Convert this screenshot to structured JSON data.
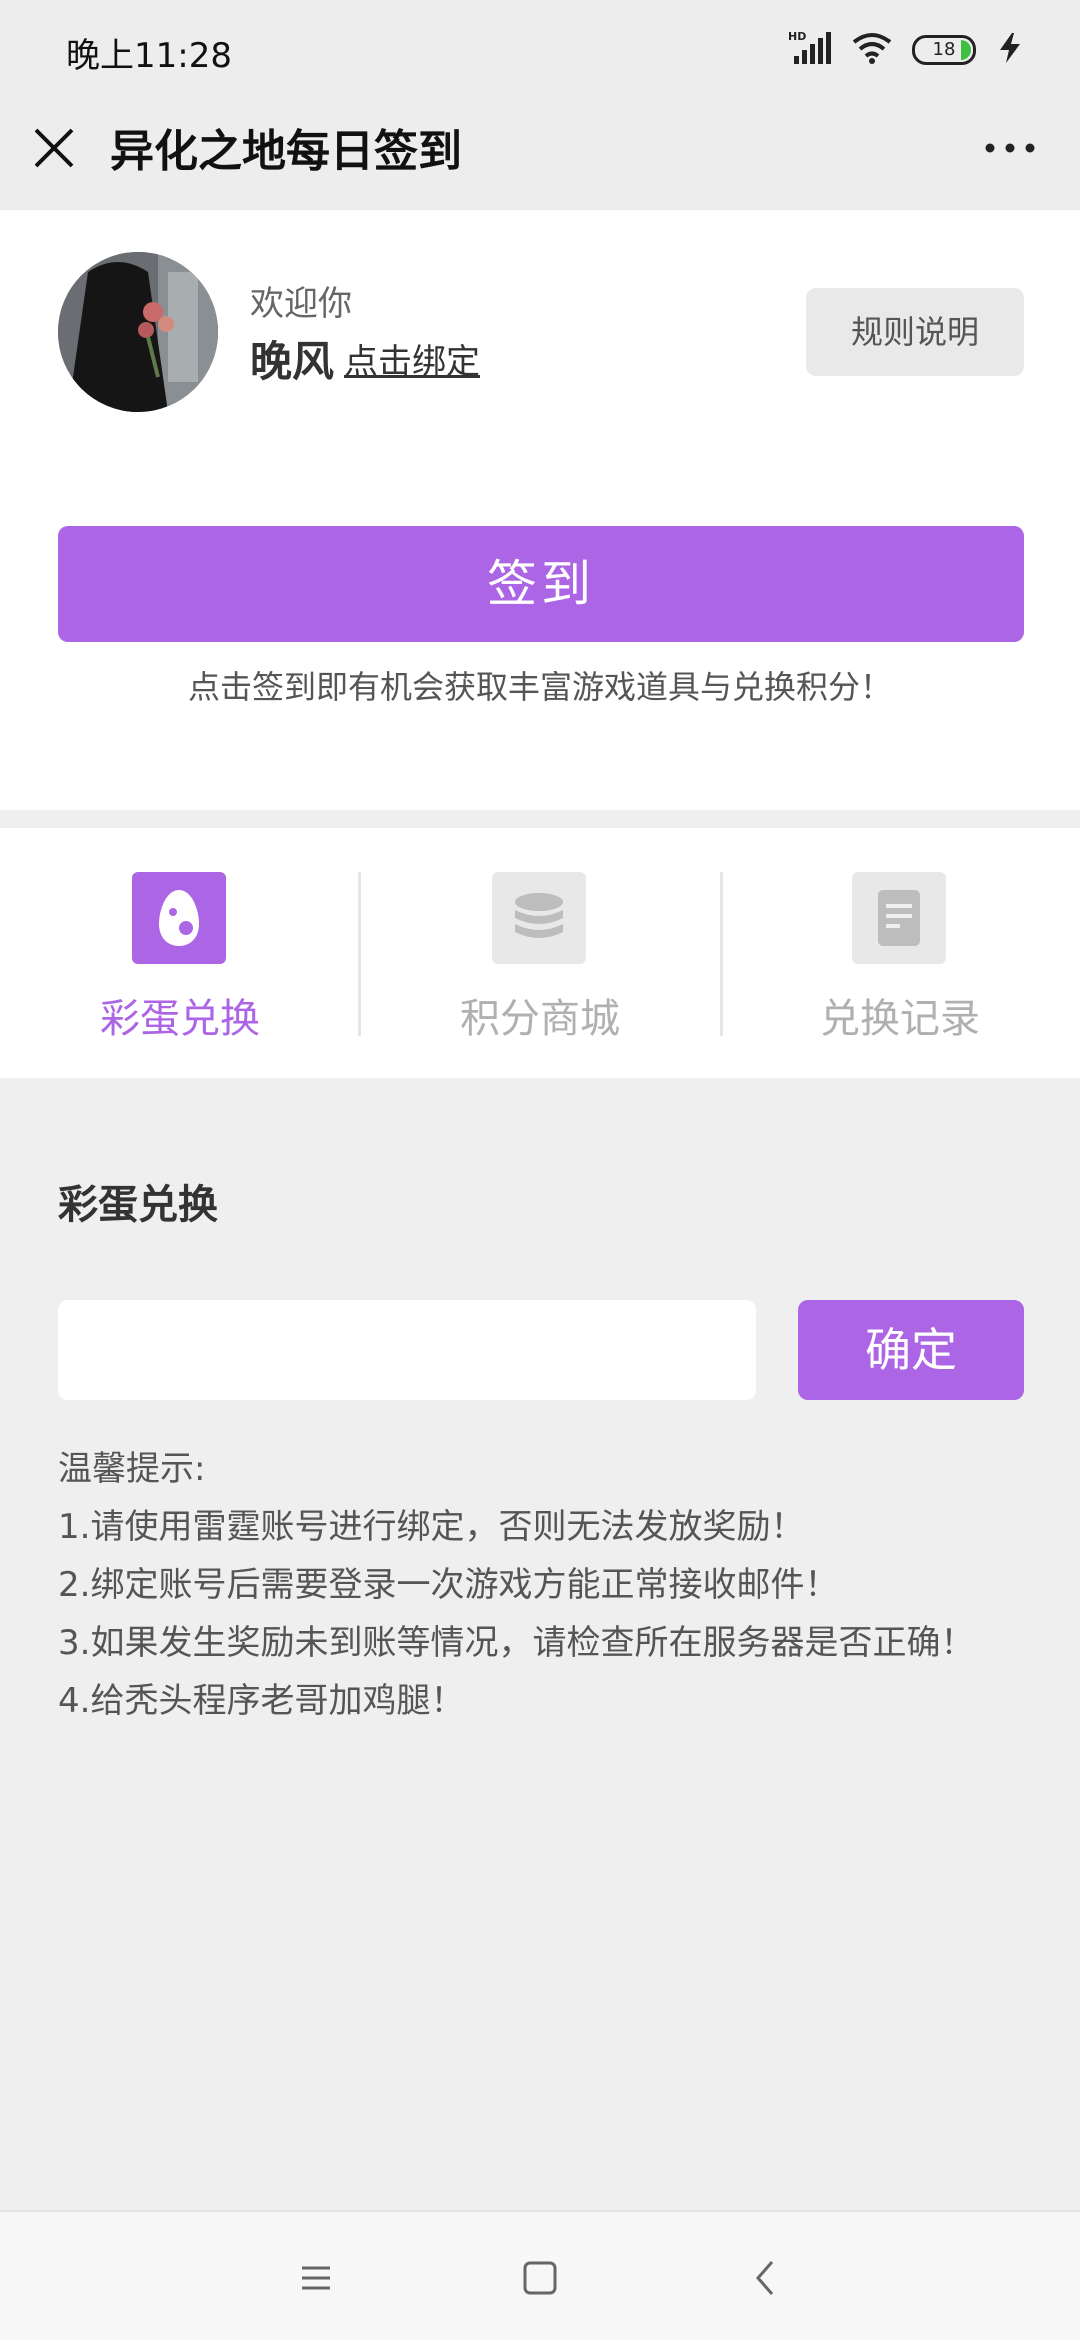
{
  "status_bar": {
    "time": "晚上11:28",
    "network_label": "HD",
    "battery_level": "18"
  },
  "nav": {
    "title": "异化之地每日签到",
    "close_icon": "close-icon",
    "more_icon": "more-icon"
  },
  "profile": {
    "welcome": "欢迎你",
    "username": "晚风",
    "bind_link": "点击绑定",
    "rules_button": "规则说明"
  },
  "checkin": {
    "button_label": "签到",
    "tip": "点击签到即有机会获取丰富游戏道具与兑换积分！"
  },
  "tabs": [
    {
      "label": "彩蛋兑换",
      "icon": "egg-icon",
      "active": true
    },
    {
      "label": "积分商城",
      "icon": "coins-icon",
      "active": false
    },
    {
      "label": "兑换记录",
      "icon": "record-icon",
      "active": false
    }
  ],
  "section": {
    "title": "彩蛋兑换",
    "input_value": "",
    "input_placeholder": "",
    "confirm_button": "确定",
    "tips_heading": "温馨提示:",
    "tips": [
      "1.请使用雷霆账号进行绑定，否则无法发放奖励！",
      "2.绑定账号后需要登录一次游戏方能正常接收邮件！",
      "3.如果发生奖励未到账等情况，请检查所在服务器是否正确！",
      "4.给秃头程序老哥加鸡腿！"
    ]
  },
  "colors": {
    "accent": "#ac65e5",
    "inactive": "#b0b0b0"
  },
  "system_nav": {
    "menu_icon": "menu-icon",
    "home_icon": "home-icon",
    "back_icon": "back-icon"
  }
}
